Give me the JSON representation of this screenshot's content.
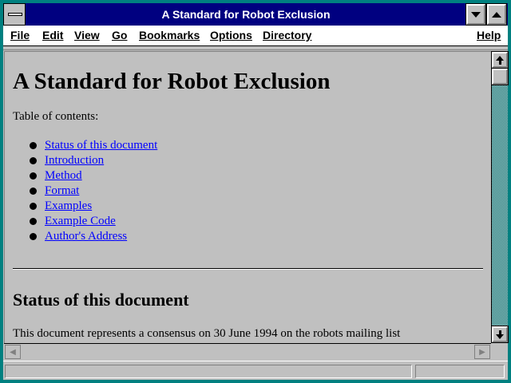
{
  "window": {
    "title": "A Standard for Robot Exclusion"
  },
  "menu": [
    {
      "label": "File"
    },
    {
      "label": "Edit"
    },
    {
      "label": "View"
    },
    {
      "label": "Go"
    },
    {
      "label": "Bookmarks"
    },
    {
      "label": "Options"
    },
    {
      "label": "Directory"
    },
    {
      "label": "Help"
    }
  ],
  "document": {
    "heading": "A Standard for Robot Exclusion",
    "toc_label": "Table of contents:",
    "toc": [
      "Status of this document ",
      "Introduction ",
      "Method ",
      "Format ",
      "Examples ",
      "Example Code ",
      "Author's Address "
    ],
    "section_heading": "Status of this document",
    "section_text": "This document represents a consensus on 30 June 1994 on the robots mailing list"
  },
  "status": {
    "text": ""
  },
  "colors": {
    "title_bar": "#000080",
    "background": "#c0c0c0",
    "link": "#0000ff",
    "desktop": "#008080"
  }
}
